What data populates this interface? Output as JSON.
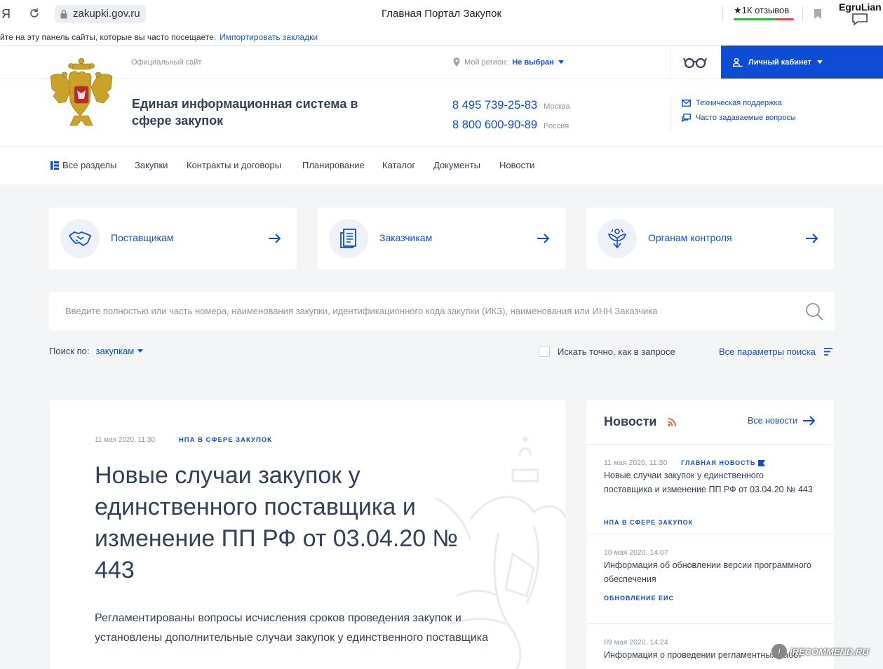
{
  "browser": {
    "ya": "Я",
    "url": "zakupki.gov.ru",
    "tab_title": "Главная Портал Закупок",
    "reviews": "★1К отзывов",
    "user": "EgruLian",
    "bookmarks_hint": "йте на эту панель сайты, которые вы часто посещаете.",
    "bookmarks_link": "Импортировать закладки"
  },
  "header": {
    "official": "Официальный сайт",
    "region_label": "Мой регион:",
    "region_value": "Не выбран",
    "cabinet": "Личный кабинет",
    "title": "Единая информационная система в сфере закупок",
    "phone_msk": "8 495 739-25-83",
    "phone_msk_city": "Москва",
    "phone_ru": "8 800 600-90-89",
    "phone_ru_city": "Россия",
    "support": "Техническая поддержка",
    "faq": "Часто задаваемые вопросы"
  },
  "nav": [
    "Все разделы",
    "Закупки",
    "Контракты и договоры",
    "Планирование",
    "Каталог",
    "Документы",
    "Новости"
  ],
  "cards": [
    "Поставщикам",
    "Заказчикам",
    "Органам контроля"
  ],
  "search": {
    "placeholder": "Введите полностью или часть номера, наименования закупки, идентификационного кода закупки (ИКЗ), наименования или ИНН Заказчика",
    "by_label": "Поиск по:",
    "by_value": "закупкам",
    "exact": "Искать точно, как в запросе",
    "all_params": "Все параметры поиска"
  },
  "feature": {
    "date": "11 мая 2020, 11:30",
    "tag": "НПА В СФЕРЕ ЗАКУПОК",
    "title": "Новые случаи закупок у единственного поставщика и изменение ПП РФ от 03.04.20 № 443",
    "desc": "Регламентированы вопросы исчисления сроков проведения закупок и установлены дополнительные случаи закупок у единственного поставщика"
  },
  "news": {
    "title": "Новости",
    "all": "Все новости",
    "items": [
      {
        "date": "11 мая 2020, 11:30",
        "badge": "ГЛАВНАЯ НОВОСТЬ",
        "text": "Новые случаи закупок у единственного поставщика и изменение ПП РФ от 03.04.20 № 443",
        "tag": "НПА В СФЕРЕ ЗАКУПОК"
      },
      {
        "date": "10 мая 2020, 14:07",
        "text": "Информация об обновлении версии программного обеспечения",
        "tag": "ОБНОВЛЕНИЕ ЕИС"
      },
      {
        "date": "09 мая 2020, 14:24",
        "text": "Информация о проведении регламентных работ"
      }
    ]
  },
  "watermark": "iRECOMMEND.RU"
}
